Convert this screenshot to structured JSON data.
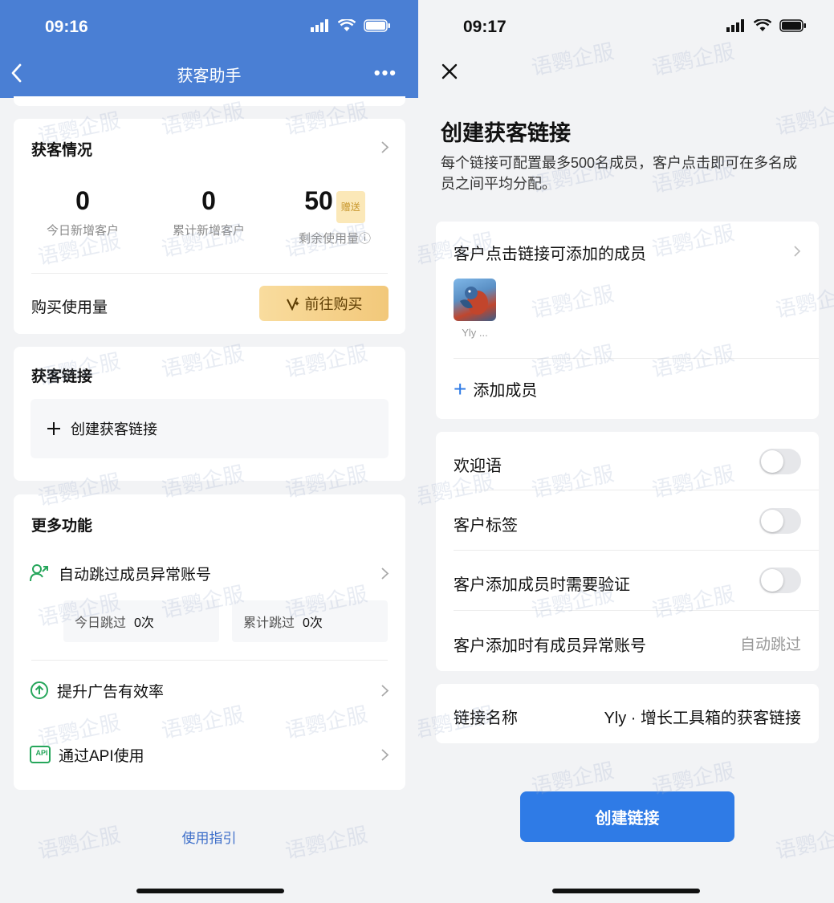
{
  "left": {
    "status_time": "09:16",
    "nav_title": "获客助手",
    "nav_more": "•••",
    "stats_card": {
      "title": "获客情况",
      "stats": [
        {
          "value": "0",
          "label": "今日新增客户"
        },
        {
          "value": "0",
          "label": "累计新增客户"
        },
        {
          "value": "50",
          "label": "剩余使用量ⓘ",
          "badge": "赠送"
        }
      ],
      "buy_label": "购买使用量",
      "buy_button": "前往购买"
    },
    "links_card": {
      "title": "获客链接",
      "create_label": "创建获客链接"
    },
    "more_card": {
      "title": "更多功能",
      "auto_skip_label": "自动跳过成员异常账号",
      "today_skip_label": "今日跳过",
      "today_skip_value": "0次",
      "total_skip_label": "累计跳过",
      "total_skip_value": "0次",
      "ad_label": "提升广告有效率",
      "api_label": "通过API使用",
      "api_icon_text": "API"
    },
    "guide_link": "使用指引"
  },
  "right": {
    "status_time": "09:17",
    "title": "创建获客链接",
    "description": "每个链接可配置最多500名成员，客户点击即可在多名成员之间平均分配。",
    "members_label": "客户点击链接可添加的成员",
    "member_name": "Yly ...",
    "add_member": "添加成员",
    "welcome_label": "欢迎语",
    "tags_label": "客户标签",
    "verify_label": "客户添加成员时需要验证",
    "abnormal_label": "客户添加时有成员异常账号",
    "abnormal_value": "自动跳过",
    "link_name_label": "链接名称",
    "link_name_value": "Yly · 增长工具箱的获客链接",
    "create_button": "创建链接"
  },
  "watermark_text": "语鹦企服",
  "colors": {
    "nav_blue": "#4a7fd4",
    "primary_blue": "#2f7be6",
    "gold_button": "#f2c87a",
    "api_green": "#26a65b"
  }
}
